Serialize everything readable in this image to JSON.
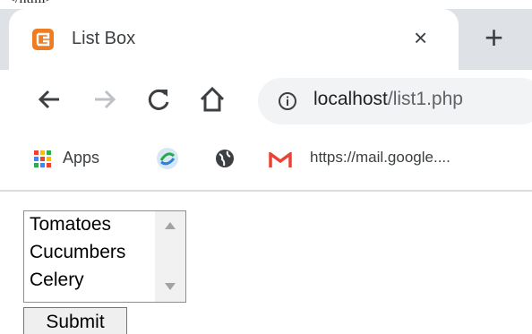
{
  "page_title_tag": "</html>",
  "tab": {
    "title": "List Box",
    "close_label": "×",
    "new_tab_label": "+"
  },
  "toolbar": {
    "url_host": "localhost",
    "url_path": "/list1.php"
  },
  "bookmarks": {
    "apps_label": "Apps",
    "gmail_label": "https://mail.google...."
  },
  "form": {
    "options": [
      "Tomatoes",
      "Cucumbers",
      "Celery"
    ],
    "submit_label": "Submit"
  },
  "colors": {
    "tab_favicon": "#f07c22",
    "gmail_red": "#ea4335"
  }
}
